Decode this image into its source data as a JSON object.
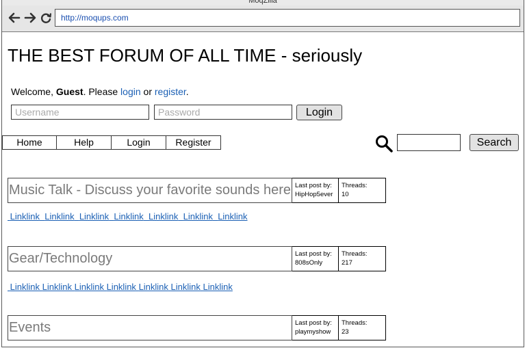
{
  "browser": {
    "title": "MoqZilla",
    "url": "http://moqups.com"
  },
  "page": {
    "title": "THE BEST FORUM OF ALL TIME - seriously"
  },
  "welcome": {
    "prefix": "Welcome, ",
    "user": "Guest",
    "middle": ". Please ",
    "login_link": "login",
    "or": " or ",
    "register_link": "register",
    "suffix": "."
  },
  "login_form": {
    "username_placeholder": "Username",
    "password_placeholder": "Password",
    "login_button": "Login"
  },
  "nav": {
    "items": [
      "Home",
      "Help",
      "Login",
      "Register"
    ]
  },
  "search": {
    "value": "",
    "button": "Search"
  },
  "forums": [
    {
      "title": "Music Talk - Discuss your favorite sounds here",
      "last_post_label": "Last post by:",
      "last_post_user": "HipHop5ever",
      "threads_label": "Threads:",
      "threads": "10",
      "links": [
        "Linklink",
        "Linklink",
        "Linklink",
        "Linklink",
        "Linklink",
        "Linklink",
        "Linklink"
      ]
    },
    {
      "title": "Gear/Technology",
      "last_post_label": "Last post by:",
      "last_post_user": "808sOnly",
      "threads_label": "Threads:",
      "threads": "217",
      "links": [
        "Linklink",
        "Linklink",
        "Linklink",
        "Linklink",
        "Linklink",
        "Linklink",
        "Linklink"
      ]
    },
    {
      "title": "Events",
      "last_post_label": "Last post by:",
      "last_post_user": "playmyshow",
      "threads_label": "Threads:",
      "threads": "23"
    }
  ]
}
